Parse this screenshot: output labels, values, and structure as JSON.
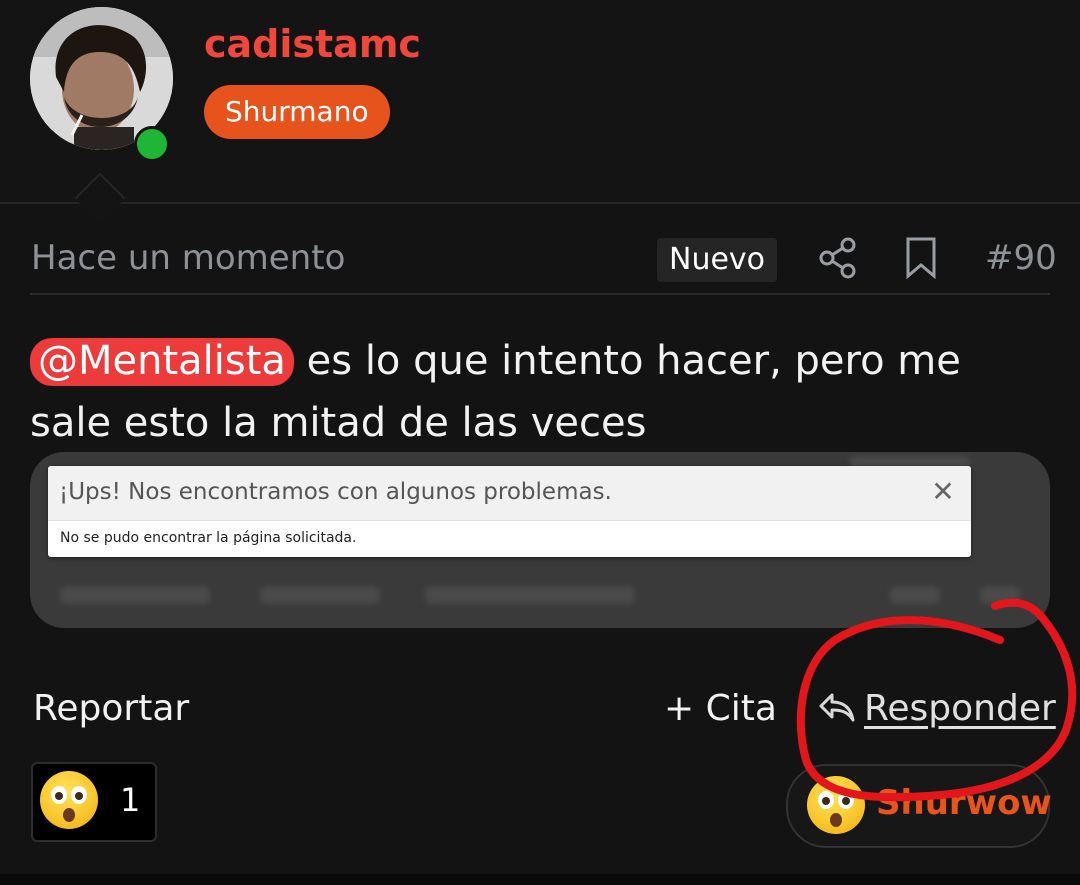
{
  "user": {
    "username": "cadistamc",
    "role": "Shurmano"
  },
  "meta": {
    "timestamp": "Hace un momento",
    "badge": "Nuevo",
    "post_number": "#90"
  },
  "post": {
    "mention": "@Mentalista",
    "text": " es lo que intento hacer, pero me sale esto la mitad de las veces"
  },
  "attachment": {
    "error_title": "¡Ups! Nos encontramos con algunos problemas.",
    "error_close": "✕",
    "error_message": "No se pudo encontrar la página solicitada."
  },
  "actions": {
    "report_label": "Reportar",
    "cite_label": "+ Cita",
    "reply_label": "Responder"
  },
  "reactions": {
    "current_emoji": "astonished-face",
    "count": "1",
    "shurwow_label": "Shurwow"
  },
  "colors": {
    "accent_red": "#f0473a",
    "role_orange": "#e6531c",
    "online_green": "#1fb535",
    "annotation_red": "#e3161b"
  }
}
